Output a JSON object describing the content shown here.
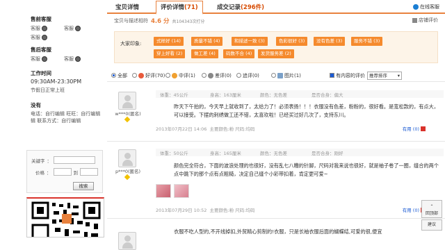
{
  "sidebar": {
    "presale": {
      "title": "售前客服",
      "agents": [
        [
          "客服",
          "客服"
        ],
        [
          "客服"
        ]
      ]
    },
    "aftersale": {
      "title": "售后客服",
      "agents": [
        [
          "客服",
          "客服"
        ]
      ]
    },
    "hours": {
      "title": "工作时间",
      "time": "09:30AM-23:30PM",
      "note": "节假日正常上班"
    },
    "contact": {
      "title": "没有",
      "lines": [
        "电话：自行编辑 旺旺：自行编辑",
        "辑 联系方式：自行编辑"
      ]
    },
    "search": {
      "keyword_label": "关键字",
      "price_label": "价格",
      "to_label": "到",
      "button": "搜索"
    }
  },
  "tabs": [
    {
      "label": "宝贝详情",
      "count": ""
    },
    {
      "label": "评价详情",
      "count": "(71)"
    },
    {
      "label": "成交记录",
      "count": "(296件)"
    }
  ],
  "online_service": "在线客服",
  "rating": {
    "label": "宝贝与描述相符",
    "score": "4.6 分",
    "raters": "共104343次打分"
  },
  "report_label": "店铺评价",
  "impression": {
    "label": "大家印象:",
    "tags": [
      "式样好 (14)",
      "质量不错 (4)",
      "和描述一致 (3)",
      "色彩很好 (3)",
      "没有色差 (3)",
      "服务不错 (3)",
      "穿上好看 (2)",
      "做工差 (4)",
      "码数不合 (4)",
      "发货服务差 (2)"
    ]
  },
  "filter": {
    "options": [
      "全部",
      "好评(70)",
      "中评(1)",
      "差评(0)",
      "追评(0)",
      "图片(1)"
    ],
    "content_only": "有内容的评价",
    "sort": "推荐排序"
  },
  "reviews": [
    {
      "user": "w***0(匿名)",
      "meta": [
        "体重：45公斤",
        "身高：163厘米",
        "颜色：无色差",
        "是否合身：偏大"
      ],
      "text": "昨天下午拍的，今天早上就收到了，太给力了！必须表扬！！！衣服没有色差，粉粉的，很好看。是宽松款的，有点大，可以接受。下摆的刺绣做工还不错，太喜欢啦！已经买过好几次了，支持东川。",
      "date": "2013年07月22日 14:06",
      "spec": "主要颜色:粉  尺码:均码",
      "useful": "有用 (0)"
    },
    {
      "user": "p***0(匿名)",
      "meta": [
        "体重：50公斤",
        "身高：165厘米",
        "颜色：无色差",
        "是否合身：刚好"
      ],
      "text": "颜色完全符合，下面的波浪处理的也很好，没有乱七八糟的针脚，尺码对我来说也很好，就是袖子卷了一圈，缝合的两个点中跳下的那个点有点粗糙，决定自己缝个小彩带扣着，肯定更可爱~",
      "date": "2013年07月29日 10:52",
      "spec": "主要颜色:粉  尺码:均码",
      "useful": "有用 (0)"
    },
    {
      "text": "衣服不吃人型的,不开线掉扣,外贸精心剪制的!衣服，只是长袖衣服后面的蝴蝶结,可爱的很,便宜"
    }
  ],
  "float": {
    "top": "回顶部",
    "suggest": "建议"
  },
  "colors": {
    "accent": "#e8813d",
    "tag": "#f58a2d",
    "link": "#1a5ad3"
  }
}
